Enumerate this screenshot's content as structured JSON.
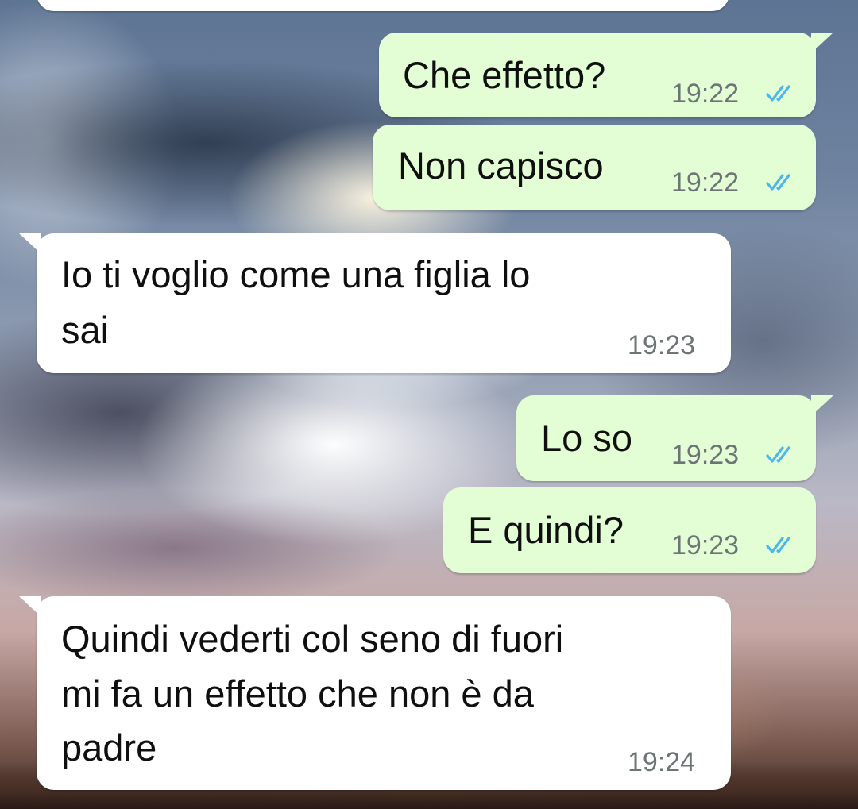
{
  "chat": {
    "messages": [
      {
        "direction": "outgoing",
        "text": "Che effetto?",
        "time": "19:22",
        "status": "double-check-read-icon"
      },
      {
        "direction": "outgoing",
        "text": "Non capisco",
        "time": "19:22",
        "status": "double-check-read-icon"
      },
      {
        "direction": "incoming",
        "lines": [
          "Io ti voglio come una figlia lo",
          "sai"
        ],
        "time": "19:23"
      },
      {
        "direction": "outgoing",
        "text": "Lo so",
        "time": "19:23",
        "status": "double-check-read-icon"
      },
      {
        "direction": "outgoing",
        "text": "E quindi?",
        "time": "19:23",
        "status": "double-check-read-icon"
      },
      {
        "direction": "incoming",
        "lines": [
          "Quindi vederti col seno di fuori",
          "mi fa un effetto che non è da",
          "padre"
        ],
        "time": "19:24"
      }
    ]
  },
  "colors": {
    "incoming_bubble": "#ffffff",
    "outgoing_bubble": "#e3fed5",
    "read_ticks": "#4fb6ec",
    "timestamp": "#6d7475"
  }
}
